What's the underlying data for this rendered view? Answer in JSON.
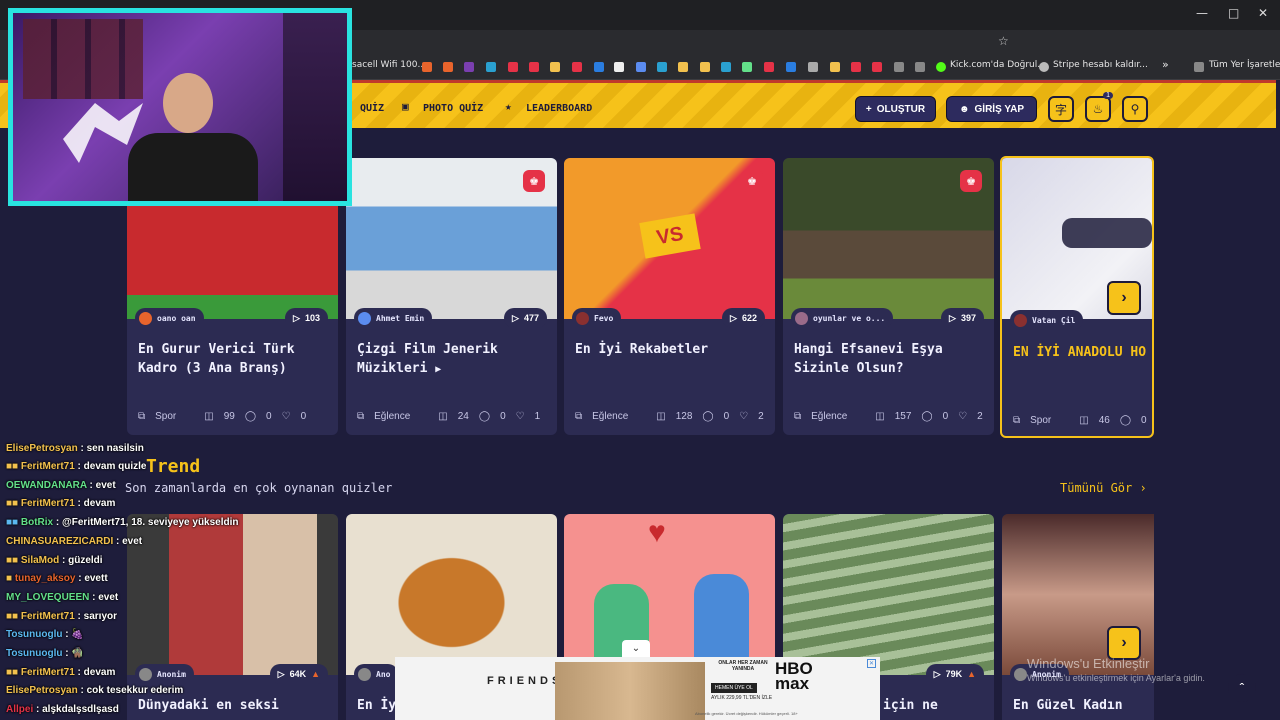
{
  "browser": {
    "bookmarks": [
      {
        "label": "sacell Wifi 100...",
        "color": "#e8e8e8"
      },
      {
        "label": "Kick.com'da Doğrul...",
        "color": "#53fc18"
      },
      {
        "label": "Stripe hesabı kaldır...",
        "color": "#bbbbbb"
      },
      {
        "label": "Tüm Yer İşaretleri",
        "color": "#bbbbbb"
      }
    ]
  },
  "nav": {
    "links": [
      "QUİZ",
      "PHOTO QUİZ",
      "LEADERBOARD"
    ],
    "create": "OLUŞTUR",
    "login": "GİRİŞ YAP",
    "notif_count": "1"
  },
  "cards_top": [
    {
      "author": "oano oan",
      "plays": "103",
      "title": "En Gurur Verici Türk Kadro (3 Ana Branş)",
      "category": "Spor",
      "questions": "99",
      "comments": "0",
      "likes": "0",
      "crown": false
    },
    {
      "author": "Ahmet Emin",
      "plays": "477",
      "title": "Çizgi Film Jenerik Müzikleri",
      "category": "Eğlence",
      "questions": "24",
      "comments": "0",
      "likes": "1",
      "crown": true
    },
    {
      "author": "Fevo",
      "plays": "622",
      "title": "En İyi Rekabetler",
      "category": "Eğlence",
      "questions": "128",
      "comments": "0",
      "likes": "2",
      "crown": true
    },
    {
      "author": "oyunlar ve o...",
      "plays": "397",
      "title": "Hangi Efsanevi Eşya Sizinle Olsun?",
      "category": "Eğlence",
      "questions": "157",
      "comments": "0",
      "likes": "2",
      "crown": true
    },
    {
      "author": "Vatan Çil",
      "plays": "",
      "title": "EN İYİ ANADOLU HO",
      "category": "Spor",
      "questions": "46",
      "comments": "0",
      "likes": "",
      "crown": false
    }
  ],
  "trend": {
    "title": "Trend",
    "subtitle": "Son zamanlarda en çok oynanan quizler",
    "see_all": "Tümünü Gör"
  },
  "cards_bottom": [
    {
      "author": "Anonim",
      "plays": "64K",
      "title": "Dünyadaki en seksi"
    },
    {
      "author": "Ano",
      "plays": "",
      "title": "En İy"
    },
    {
      "author": "",
      "plays": "",
      "title": ""
    },
    {
      "author": "",
      "plays": "79K",
      "title": "için ne"
    },
    {
      "author": "Anonim",
      "plays": "",
      "title": "En Güzel Kadın"
    }
  ],
  "chat": [
    {
      "user": "ElisePetrosyan",
      "msg": "sen nasilsin",
      "color": "#f2c14e"
    },
    {
      "user": "FeritMert71",
      "msg": "devam quizle",
      "color": "#f2c14e"
    },
    {
      "user": "OEWANDANARA",
      "msg": "evet",
      "color": "#63e08a"
    },
    {
      "user": "FeritMert71",
      "msg": "devam",
      "color": "#f2c14e"
    },
    {
      "user": "BotRix",
      "msg": "@FeritMert71, 18. seviyeye yükseldin",
      "color": "#63e08a"
    },
    {
      "user": "CHINASUAREZICARDI",
      "msg": "evet",
      "color": "#f2c14e"
    },
    {
      "user": "SilaMod",
      "msg": "güzeldi",
      "color": "#f2c14e"
    },
    {
      "user": "tunay_aksoy",
      "msg": "evett",
      "color": "#e8642c"
    },
    {
      "user": "MY_LOVEQUEEN",
      "msg": "evet",
      "color": "#63e08a"
    },
    {
      "user": "FeritMert71",
      "msg": "sarıyor",
      "color": "#f2c14e"
    },
    {
      "user": "Tosunuoglu",
      "msg": "🍇",
      "color": "#5bb8f0"
    },
    {
      "user": "Tosunuoglu",
      "msg": "🧌",
      "color": "#5bb8f0"
    },
    {
      "user": "FeritMert71",
      "msg": "devam",
      "color": "#f2c14e"
    },
    {
      "user": "ElisePetrosyan",
      "msg": "cok tesekkur ederim",
      "color": "#f2c14e"
    },
    {
      "user": "Allpei",
      "msg": "alşkdalşsdlşasd",
      "color": "#e53247"
    }
  ],
  "ad": {
    "brand": "FRIENDS",
    "platform": "HBO max",
    "tag1": "ONLAR HER ZAMAN YANINDA",
    "cta": "HEMEN ÜYE OL",
    "price": "AYLIK 229,99 TL'DEN İZLE",
    "fine": "Abonelik gerekir. Ücret değişkendir. Hükümler geçerli. 18+"
  },
  "windows": {
    "line1": "Windows'u Etkinleştir",
    "line2": "Windows'u etkinleştirmek için Ayarlar'a gidin."
  }
}
